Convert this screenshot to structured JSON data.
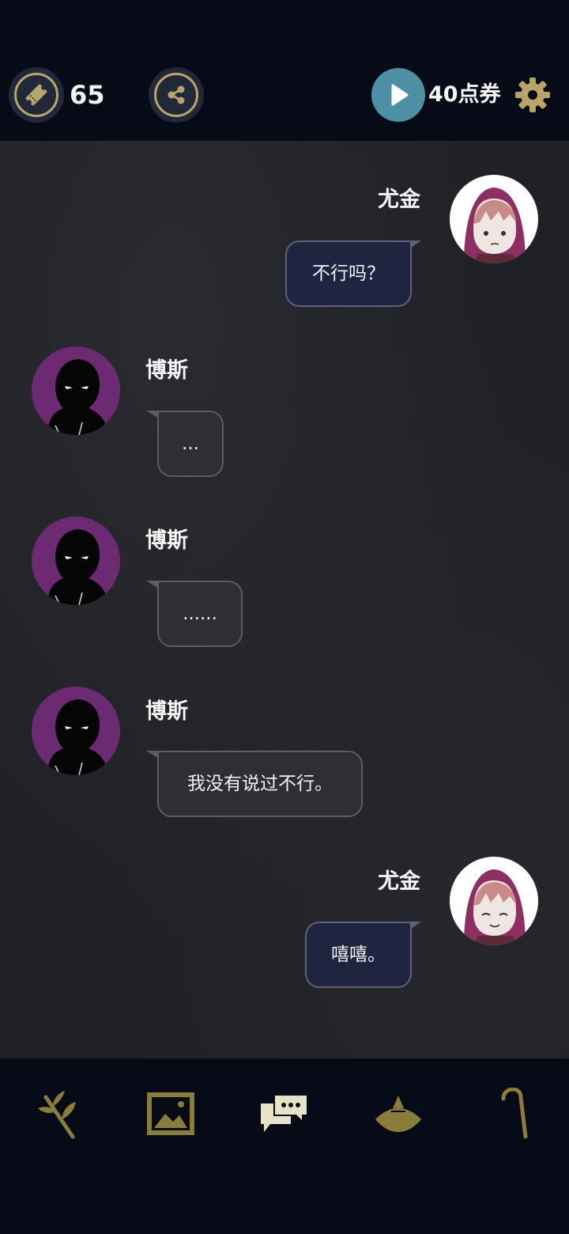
{
  "topbar": {
    "ticket_count": "65",
    "coupon_label": "40点券",
    "icons": {
      "ticket": "ticket-icon",
      "share": "share-icon",
      "play": "play-icon",
      "settings": "gear-icon"
    },
    "colors": {
      "gold": "#b9a569",
      "play_bg": "#4d8fa4"
    }
  },
  "chat": {
    "messages": [
      {
        "speaker": "尤金",
        "side": "right",
        "text": "不行吗？",
        "avatar": "yujin-avatar"
      },
      {
        "speaker": "博斯",
        "side": "left",
        "text": "...",
        "avatar": "bosi-avatar"
      },
      {
        "speaker": "博斯",
        "side": "left",
        "text": "......",
        "avatar": "bosi-avatar"
      },
      {
        "speaker": "博斯",
        "side": "left",
        "text": "我没有说过不行。",
        "avatar": "bosi-avatar"
      },
      {
        "speaker": "尤金",
        "side": "right",
        "text": "嘻嘻。",
        "avatar": "yujin-avatar"
      }
    ]
  },
  "bottomnav": {
    "items": [
      {
        "icon": "branch-icon"
      },
      {
        "icon": "gallery-icon"
      },
      {
        "icon": "chat-icon",
        "active": true
      },
      {
        "icon": "hat-icon"
      },
      {
        "icon": "cane-icon"
      }
    ],
    "colors": {
      "inactive": "#8a7d3c",
      "active": "#e8e2c6"
    }
  }
}
